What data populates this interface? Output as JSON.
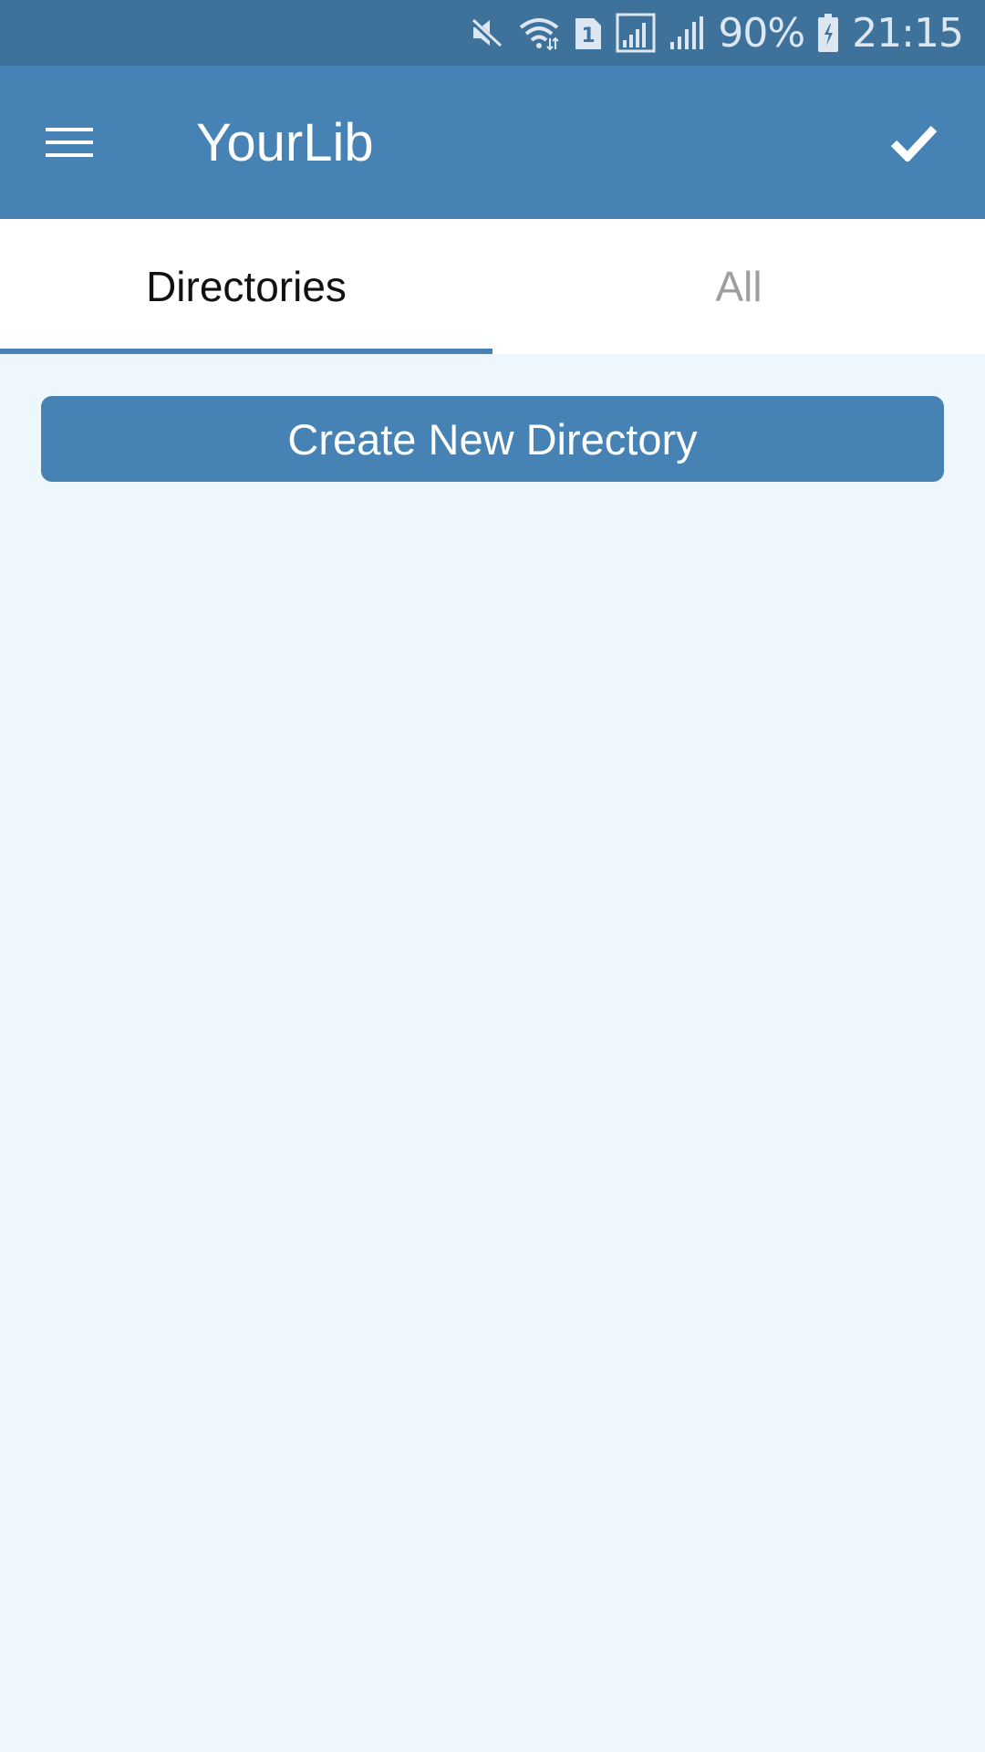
{
  "status_bar": {
    "battery_percent": "90%",
    "time": "21:15",
    "sim_label": "1",
    "icons": [
      "mute-icon",
      "wifi-icon",
      "sim-icon",
      "signal-icon",
      "signal-icon",
      "battery-charging-icon"
    ]
  },
  "app_bar": {
    "title": "YourLib",
    "menu_icon": "hamburger-menu-icon",
    "action_icon": "checkmark-icon"
  },
  "tabs": [
    {
      "label": "Directories",
      "active": true
    },
    {
      "label": "All",
      "active": false
    }
  ],
  "main": {
    "create_button_label": "Create New Directory"
  },
  "colors": {
    "status_bar": "#3f729b",
    "app_bar": "#4682b4",
    "accent": "#4682b4",
    "background": "#eef6fe",
    "tab_inactive": "#9e9e9e"
  }
}
